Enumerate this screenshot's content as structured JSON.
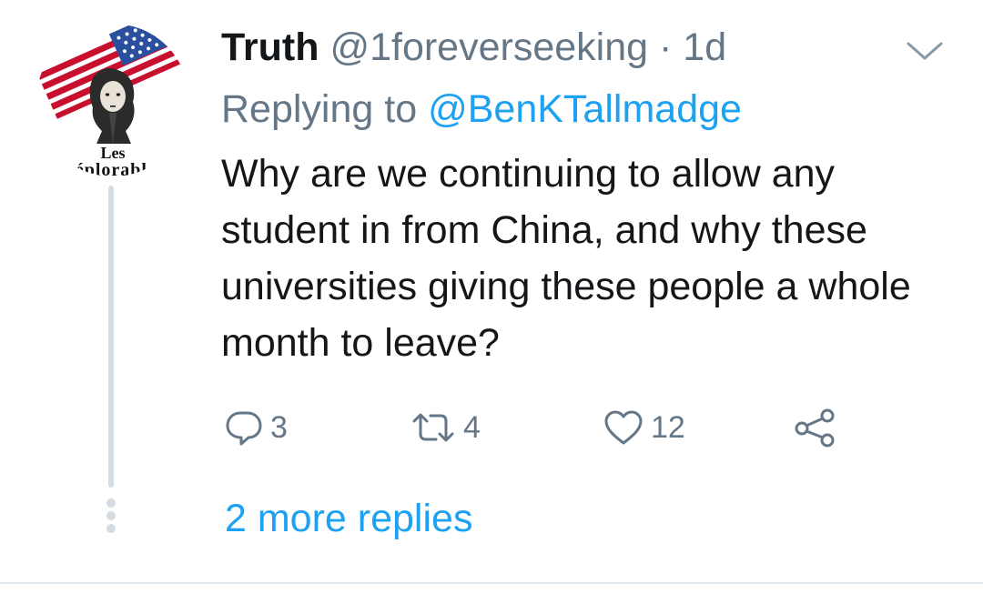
{
  "tweet": {
    "display_name": "Truth",
    "handle": "@1foreverseeking",
    "separator": "·",
    "time": "1d",
    "replying_prefix": "Replying to",
    "replying_to": "@BenKTallmadge",
    "text": "Why are we continuing to allow any student in from China, and why these universities giving these people a whole month to leave?",
    "avatar": {
      "line1": "Les",
      "line2": "Déplorables"
    },
    "actions": {
      "reply": {
        "icon": "reply-icon",
        "count": "3"
      },
      "retweet": {
        "icon": "retweet-icon",
        "count": "4"
      },
      "like": {
        "icon": "heart-icon",
        "count": "12"
      },
      "share": {
        "icon": "share-icon",
        "count": ""
      }
    },
    "more_replies": "2 more replies"
  },
  "colors": {
    "text": "#14171a",
    "secondary": "#657786",
    "link": "#1da1f2",
    "thread_line": "#d4dce3",
    "flag_red": "#c8102e",
    "flag_blue": "#2a4f9e"
  }
}
